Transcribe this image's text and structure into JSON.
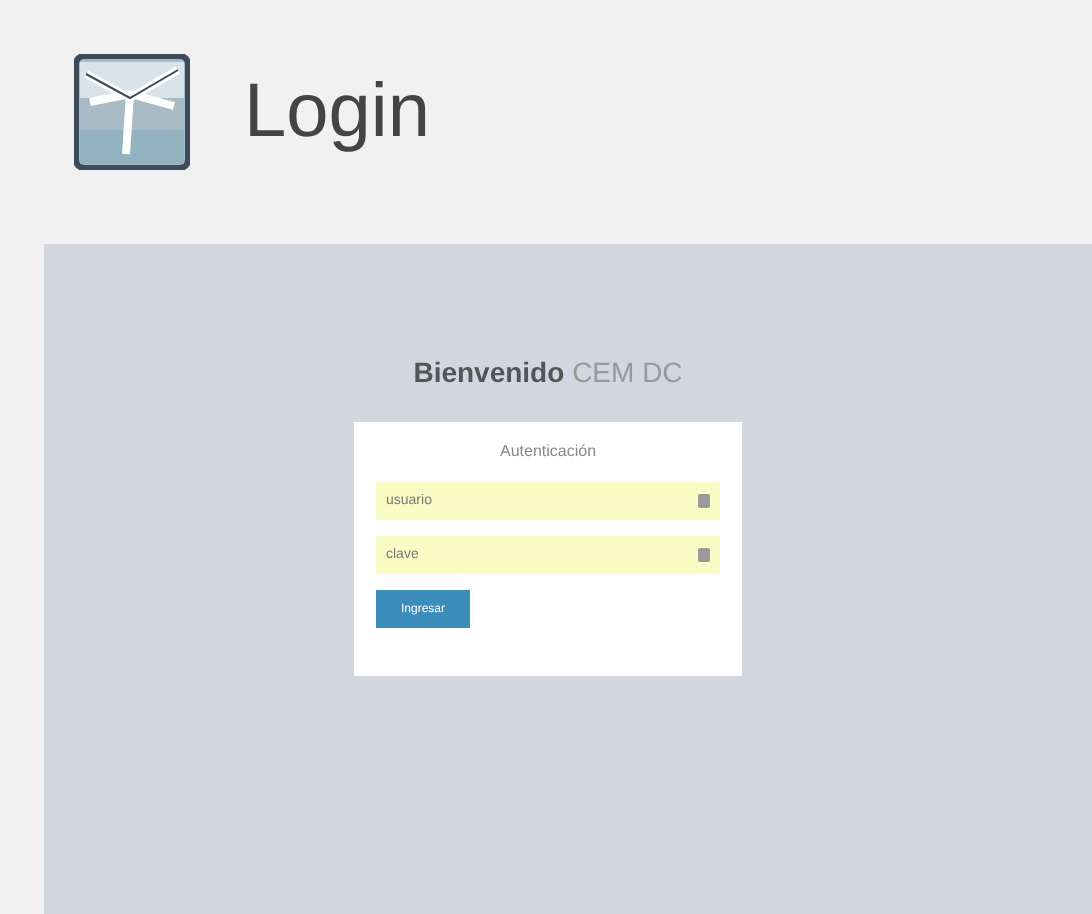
{
  "header": {
    "title": "Login"
  },
  "welcome": {
    "bold": "Bienvenido",
    "light": "CEM DC"
  },
  "form": {
    "heading": "Autenticación",
    "fields": [
      {
        "placeholder": "usuario"
      },
      {
        "placeholder": "clave"
      }
    ],
    "button": "Ingresar"
  }
}
